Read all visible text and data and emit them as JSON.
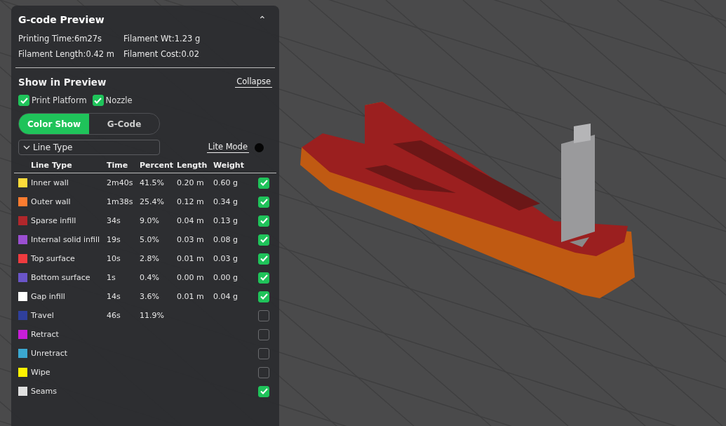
{
  "panel": {
    "title": "G-code Preview",
    "collapse_icon": "⌃",
    "stats": [
      {
        "label": "Printing Time:6m27s"
      },
      {
        "label": "Filament Wt:1.23 g"
      },
      {
        "label": "Filament Length:0.42 m"
      },
      {
        "label": "Filament Cost:0.02"
      }
    ],
    "section_title": "Show in Preview",
    "collapse_link": "Collapse",
    "toggles": [
      {
        "label": "Print Platform",
        "checked": true
      },
      {
        "label": "Nozzle",
        "checked": true
      }
    ],
    "modes": [
      {
        "label": "Color Show",
        "selected": true
      },
      {
        "label": "G-Code",
        "selected": false
      }
    ],
    "view_select": {
      "value": "Line Type"
    },
    "lite_mode": {
      "label": "Lite Mode",
      "on": false
    },
    "table": {
      "columns": [
        "Line Type",
        "Time",
        "Percent",
        "Length",
        "Weight"
      ],
      "rows": [
        {
          "color": "#fddb3a",
          "name": "Inner wall",
          "time": "2m40s",
          "percent": "41.5%",
          "length": "0.20 m",
          "weight": "0.60 g",
          "checked": true
        },
        {
          "color": "#fb7c30",
          "name": "Outer wall",
          "time": "1m38s",
          "percent": "25.4%",
          "length": "0.12 m",
          "weight": "0.34 g",
          "checked": true
        },
        {
          "color": "#b0272b",
          "name": "Sparse infill",
          "time": "34s",
          "percent": "9.0%",
          "length": "0.04 m",
          "weight": "0.13 g",
          "checked": true
        },
        {
          "color": "#9b4fd1",
          "name": "Internal solid infill",
          "time": "19s",
          "percent": "5.0%",
          "length": "0.03 m",
          "weight": "0.08 g",
          "checked": true
        },
        {
          "color": "#ef3b3f",
          "name": "Top surface",
          "time": "10s",
          "percent": "2.8%",
          "length": "0.01 m",
          "weight": "0.03 g",
          "checked": true
        },
        {
          "color": "#6a55c9",
          "name": "Bottom surface",
          "time": "1s",
          "percent": "0.4%",
          "length": "0.00 m",
          "weight": "0.00 g",
          "checked": true
        },
        {
          "color": "#ffffff",
          "name": "Gap infill",
          "time": "14s",
          "percent": "3.6%",
          "length": "0.01 m",
          "weight": "0.04 g",
          "checked": true
        },
        {
          "color": "#2f3f9b",
          "name": "Travel",
          "time": "46s",
          "percent": "11.9%",
          "checked": false
        },
        {
          "color": "#c81ed8",
          "name": "Retract",
          "checked": false
        },
        {
          "color": "#3ba8d1",
          "name": "Unretract",
          "checked": false
        },
        {
          "color": "#fff200",
          "name": "Wipe",
          "checked": false
        },
        {
          "color": "#e0e0e0",
          "name": "Seams",
          "checked": true
        }
      ]
    }
  }
}
